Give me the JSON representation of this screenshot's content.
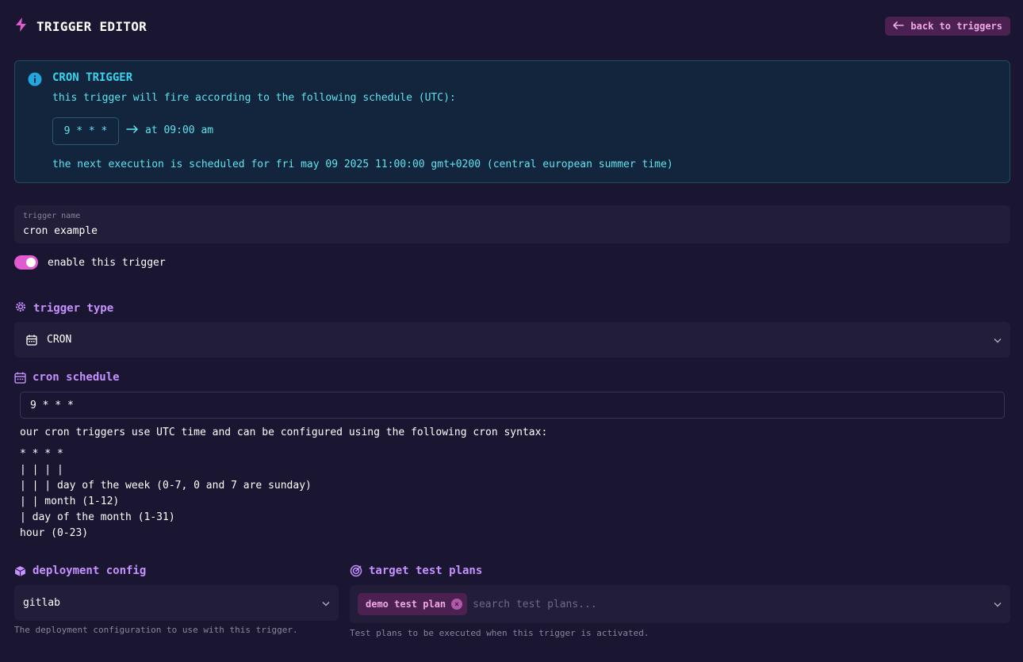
{
  "header": {
    "title": "TRIGGER EDITOR",
    "back_label": "back to triggers"
  },
  "info": {
    "title": "CRON TRIGGER",
    "description": "this trigger will fire according to the following schedule (UTC):",
    "cron_expression": "9 * * *",
    "human_readable": "at 09:00 am",
    "next_execution": "the next execution is scheduled for fri may 09 2025 11:00:00 gmt+0200 (central european summer time)"
  },
  "trigger_name": {
    "label": "trigger name",
    "value": "cron example"
  },
  "enable": {
    "label": "enable this trigger",
    "enabled": true
  },
  "trigger_type": {
    "heading": "trigger type",
    "selected": "CRON"
  },
  "cron_schedule": {
    "heading": "cron schedule",
    "value": "9 * * *",
    "help": "our cron triggers use UTC time and can be configured using the following cron syntax:",
    "syntax_lines": [
      "* * * *",
      "| | | |",
      "| | | day of the week (0-7, 0 and 7 are sunday)",
      "| | month (1-12)",
      "| day of the month (1-31)",
      "hour (0-23)"
    ]
  },
  "deployment": {
    "heading": "deployment config",
    "selected": "gitlab",
    "hint": "The deployment configuration to use with this trigger."
  },
  "targets": {
    "heading": "target test plans",
    "chips": [
      "demo test plan"
    ],
    "placeholder": "search test plans...",
    "hint": "Test plans to be executed when this trigger is activated."
  },
  "colors": {
    "background": "#1a1530",
    "accent_pink": "#e05ad0",
    "accent_purple": "#c592ff",
    "info_cyan": "#3ad4ef"
  }
}
